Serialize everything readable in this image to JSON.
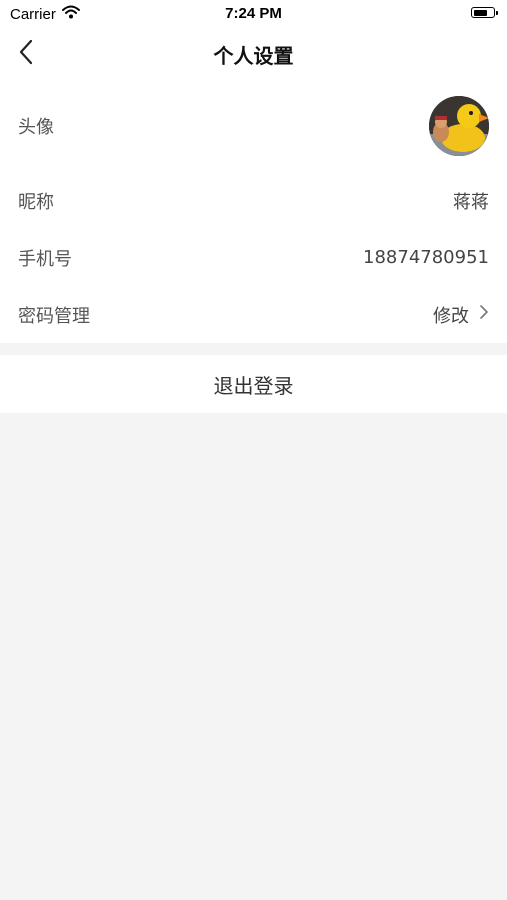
{
  "status_bar": {
    "carrier": "Carrier",
    "time": "7:24 PM",
    "battery_level": 0.75
  },
  "nav": {
    "title": "个人设置",
    "back_icon": "chevron-left-icon"
  },
  "settings": {
    "avatar_label": "头像",
    "nickname_label": "昵称",
    "nickname_value": "蒋蒋",
    "phone_label": "手机号",
    "phone_value": "18874780951",
    "password_label": "密码管理",
    "password_action": "修改"
  },
  "logout_label": "退出登录",
  "colors": {
    "background": "#f4f4f4",
    "card": "#ffffff",
    "text": "#333333"
  }
}
